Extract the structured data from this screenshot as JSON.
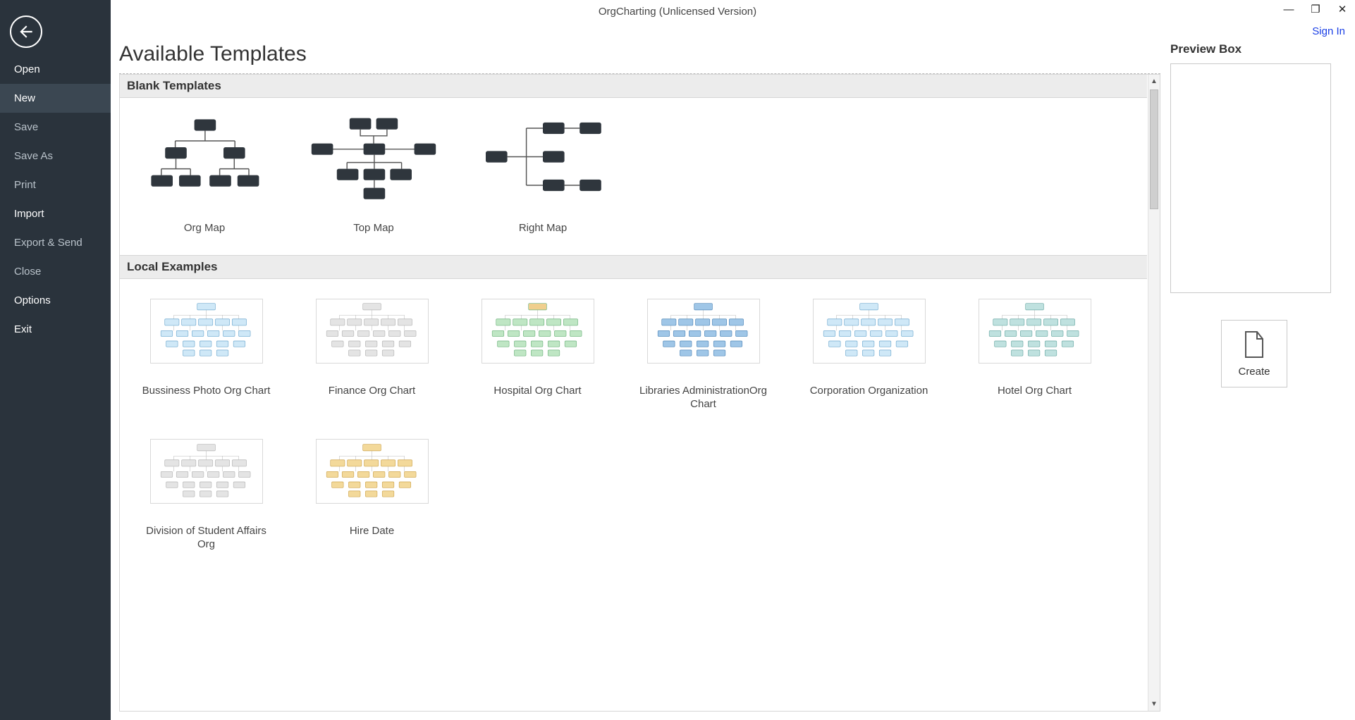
{
  "window": {
    "title": "OrgCharting (Unlicensed Version)",
    "sign_in": "Sign In"
  },
  "sidebar": {
    "items": [
      {
        "label": "Open",
        "bright": true
      },
      {
        "label": "New",
        "bright": true,
        "active": true
      },
      {
        "label": "Save"
      },
      {
        "label": "Save As"
      },
      {
        "label": "Print"
      },
      {
        "label": "Import",
        "bright": true
      },
      {
        "label": "Export & Send"
      },
      {
        "label": "Close"
      },
      {
        "label": "Options",
        "bright": true
      },
      {
        "label": "Exit",
        "bright": true
      }
    ]
  },
  "page": {
    "title": "Available Templates"
  },
  "sections": {
    "blank": {
      "header": "Blank Templates",
      "items": [
        {
          "id": "org-map",
          "label": "Org Map"
        },
        {
          "id": "top-map",
          "label": "Top Map"
        },
        {
          "id": "right-map",
          "label": "Right Map"
        }
      ]
    },
    "examples": {
      "header": "Local Examples",
      "items": [
        {
          "id": "business-photo",
          "label": "Bussiness Photo Org Chart",
          "palette": "ltblue"
        },
        {
          "id": "finance",
          "label": "Finance Org Chart",
          "palette": "gray"
        },
        {
          "id": "hospital",
          "label": "Hospital Org Chart",
          "palette": "green"
        },
        {
          "id": "libraries",
          "label": "Libraries AdministrationOrg Chart",
          "palette": "blue"
        },
        {
          "id": "corporation",
          "label": "Corporation Organization",
          "palette": "ltblue"
        },
        {
          "id": "hotel",
          "label": "Hotel Org Chart",
          "palette": "teal"
        },
        {
          "id": "student-affairs",
          "label": "Division of Student Affairs Org",
          "palette": "gray"
        },
        {
          "id": "hire-date",
          "label": "Hire Date",
          "palette": "gold"
        }
      ]
    }
  },
  "preview": {
    "title": "Preview Box",
    "create_label": "Create"
  }
}
